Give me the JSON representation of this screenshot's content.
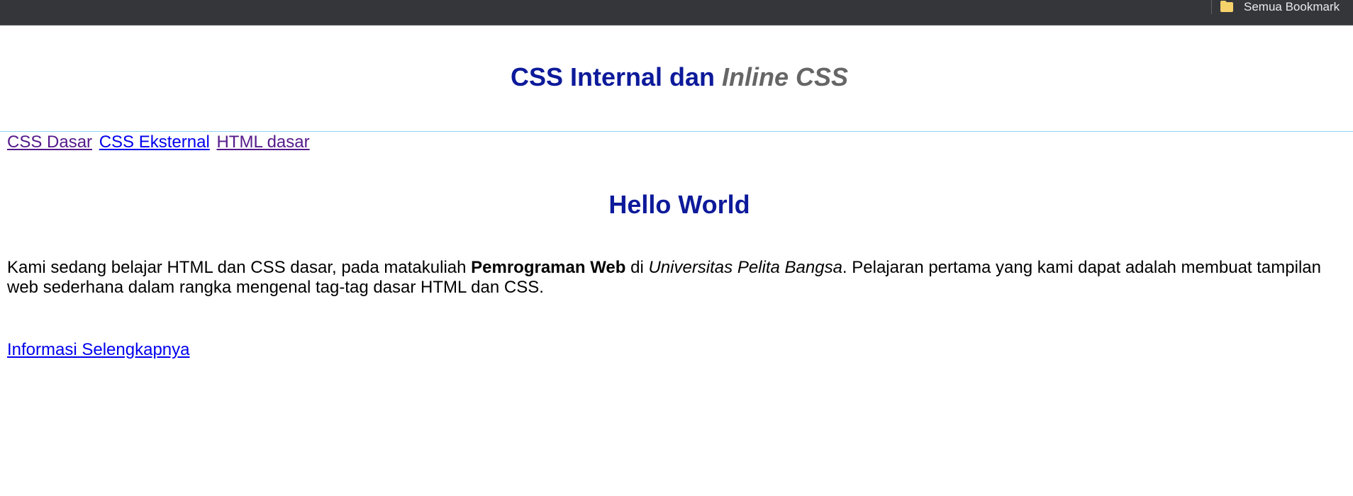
{
  "browser": {
    "bookmarks_label": "Semua Bookmark",
    "folder_color": "#f6d26b"
  },
  "header": {
    "title_main": "CSS Internal dan ",
    "title_italic": "Inline CSS"
  },
  "nav": {
    "links": [
      {
        "label": "CSS Dasar",
        "state": "visited"
      },
      {
        "label": "CSS Eksternal",
        "state": "unvisited"
      },
      {
        "label": "HTML dasar",
        "state": "visited"
      }
    ]
  },
  "content": {
    "heading": "Hello World",
    "paragraph": {
      "part1": "Kami sedang belajar HTML dan CSS dasar, pada matakuliah ",
      "bold": "Pemrograman Web",
      "part2": " di ",
      "italic": "Universitas Pelita Bangsa",
      "part3": ". Pelajaran pertama yang kami dapat adalah membuat tampilan web sederhana dalam rangka mengenal tag-tag dasar HTML dan CSS."
    },
    "more_link": "Informasi Selengkapnya"
  },
  "colors": {
    "heading": "#0d1a9a",
    "italic_title": "#666666",
    "link_visited": "#551a8b",
    "link_unvisited": "#0000ee",
    "rule": "#8fd8f0",
    "browser_bar": "#35363a"
  }
}
